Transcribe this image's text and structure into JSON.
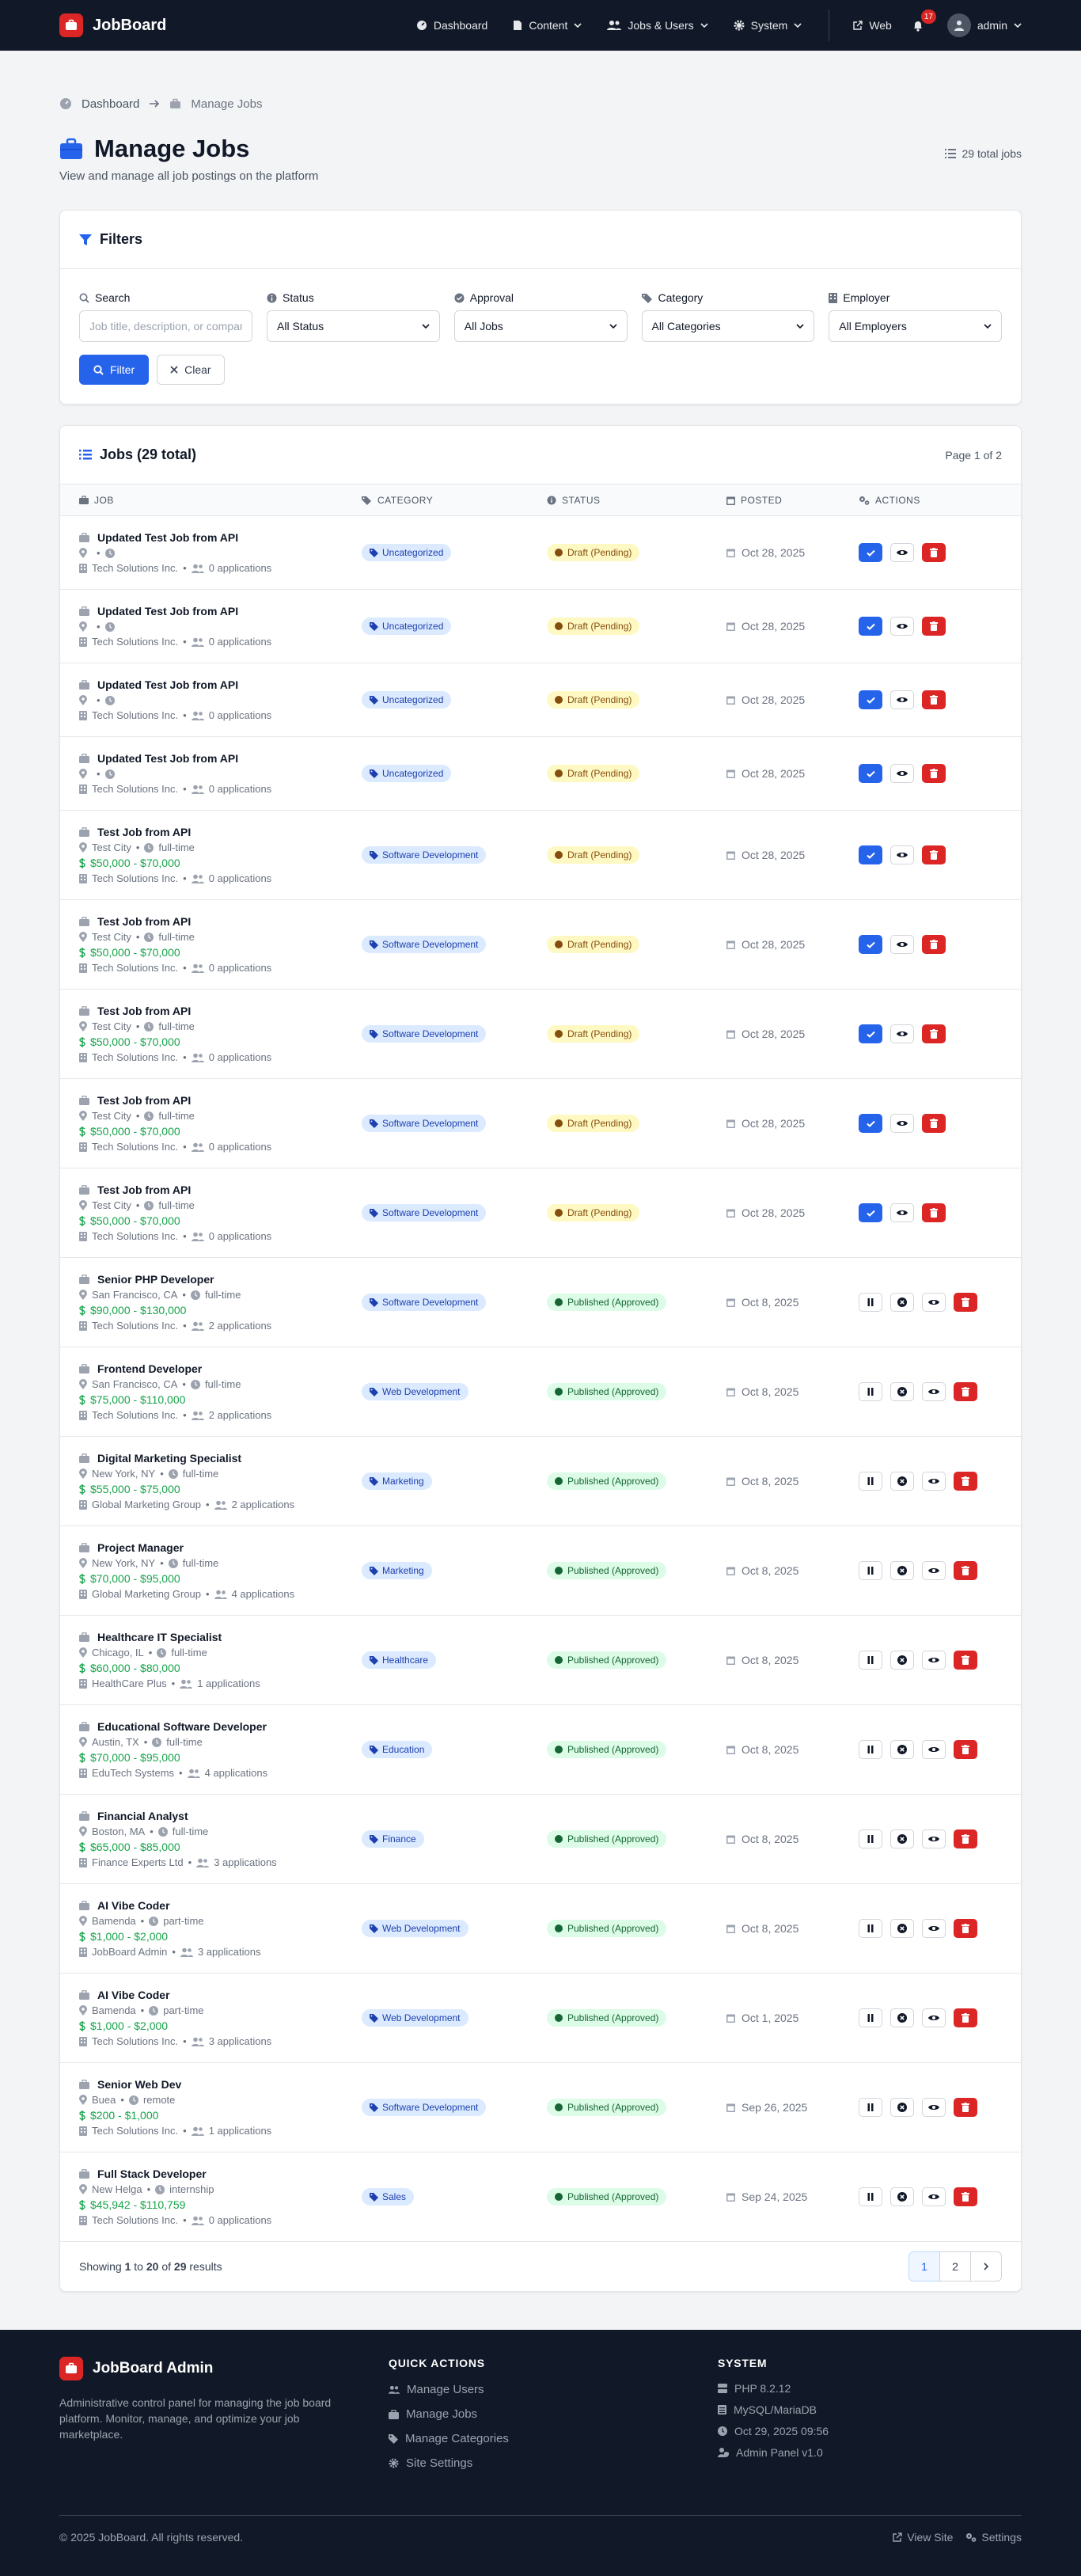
{
  "nav": {
    "brand": "JobBoard",
    "items": [
      {
        "label": "Dashboard",
        "icon": "gauge-icon",
        "caret": false
      },
      {
        "label": "Content",
        "icon": "file-icon",
        "caret": true
      },
      {
        "label": "Jobs & Users",
        "icon": "users-icon",
        "caret": true
      },
      {
        "label": "System",
        "icon": "gear-icon",
        "caret": true
      }
    ],
    "web": "Web",
    "notif_count": "17",
    "user": "admin"
  },
  "breadcrumb": {
    "home": "Dashboard",
    "current": "Manage Jobs"
  },
  "header": {
    "title": "Manage Jobs",
    "subtitle": "View and manage all job postings on the platform",
    "total": "29 total jobs"
  },
  "filters": {
    "title": "Filters",
    "search_label": "Search",
    "search_placeholder": "Job title, description, or company",
    "status_label": "Status",
    "status_value": "All Status",
    "approval_label": "Approval",
    "approval_value": "All Jobs",
    "category_label": "Category",
    "category_value": "All Categories",
    "employer_label": "Employer",
    "employer_value": "All Employers",
    "filter_btn": "Filter",
    "clear_btn": "Clear"
  },
  "jobs": {
    "title": "Jobs (29 total)",
    "page_of": "Page 1 of 2",
    "columns": [
      "Job",
      "Category",
      "Status",
      "Posted",
      "Actions"
    ],
    "rows": [
      {
        "title": "Updated Test Job from API",
        "location": "",
        "type": "",
        "salary": "",
        "company": "Tech Solutions Inc.",
        "applications": "0 applications",
        "category": "Uncategorized",
        "status": "Draft (Pending)",
        "kind": "draft",
        "posted": "Oct 28, 2025"
      },
      {
        "title": "Updated Test Job from API",
        "location": "",
        "type": "",
        "salary": "",
        "company": "Tech Solutions Inc.",
        "applications": "0 applications",
        "category": "Uncategorized",
        "status": "Draft (Pending)",
        "kind": "draft",
        "posted": "Oct 28, 2025"
      },
      {
        "title": "Updated Test Job from API",
        "location": "",
        "type": "",
        "salary": "",
        "company": "Tech Solutions Inc.",
        "applications": "0 applications",
        "category": "Uncategorized",
        "status": "Draft (Pending)",
        "kind": "draft",
        "posted": "Oct 28, 2025"
      },
      {
        "title": "Updated Test Job from API",
        "location": "",
        "type": "",
        "salary": "",
        "company": "Tech Solutions Inc.",
        "applications": "0 applications",
        "category": "Uncategorized",
        "status": "Draft (Pending)",
        "kind": "draft",
        "posted": "Oct 28, 2025"
      },
      {
        "title": "Test Job from API",
        "location": "Test City",
        "type": "full-time",
        "salary": "$50,000 - $70,000",
        "company": "Tech Solutions Inc.",
        "applications": "0 applications",
        "category": "Software Development",
        "status": "Draft (Pending)",
        "kind": "draft",
        "posted": "Oct 28, 2025"
      },
      {
        "title": "Test Job from API",
        "location": "Test City",
        "type": "full-time",
        "salary": "$50,000 - $70,000",
        "company": "Tech Solutions Inc.",
        "applications": "0 applications",
        "category": "Software Development",
        "status": "Draft (Pending)",
        "kind": "draft",
        "posted": "Oct 28, 2025"
      },
      {
        "title": "Test Job from API",
        "location": "Test City",
        "type": "full-time",
        "salary": "$50,000 - $70,000",
        "company": "Tech Solutions Inc.",
        "applications": "0 applications",
        "category": "Software Development",
        "status": "Draft (Pending)",
        "kind": "draft",
        "posted": "Oct 28, 2025"
      },
      {
        "title": "Test Job from API",
        "location": "Test City",
        "type": "full-time",
        "salary": "$50,000 - $70,000",
        "company": "Tech Solutions Inc.",
        "applications": "0 applications",
        "category": "Software Development",
        "status": "Draft (Pending)",
        "kind": "draft",
        "posted": "Oct 28, 2025"
      },
      {
        "title": "Test Job from API",
        "location": "Test City",
        "type": "full-time",
        "salary": "$50,000 - $70,000",
        "company": "Tech Solutions Inc.",
        "applications": "0 applications",
        "category": "Software Development",
        "status": "Draft (Pending)",
        "kind": "draft",
        "posted": "Oct 28, 2025"
      },
      {
        "title": "Senior PHP Developer",
        "location": "San Francisco, CA",
        "type": "full-time",
        "salary": "$90,000 - $130,000",
        "company": "Tech Solutions Inc.",
        "applications": "2 applications",
        "category": "Software Development",
        "status": "Published (Approved)",
        "kind": "pub",
        "posted": "Oct 8, 2025"
      },
      {
        "title": "Frontend Developer",
        "location": "San Francisco, CA",
        "type": "full-time",
        "salary": "$75,000 - $110,000",
        "company": "Tech Solutions Inc.",
        "applications": "2 applications",
        "category": "Web Development",
        "status": "Published (Approved)",
        "kind": "pub",
        "posted": "Oct 8, 2025"
      },
      {
        "title": "Digital Marketing Specialist",
        "location": "New York, NY",
        "type": "full-time",
        "salary": "$55,000 - $75,000",
        "company": "Global Marketing Group",
        "applications": "2 applications",
        "category": "Marketing",
        "status": "Published (Approved)",
        "kind": "pub",
        "posted": "Oct 8, 2025"
      },
      {
        "title": "Project Manager",
        "location": "New York, NY",
        "type": "full-time",
        "salary": "$70,000 - $95,000",
        "company": "Global Marketing Group",
        "applications": "4 applications",
        "category": "Marketing",
        "status": "Published (Approved)",
        "kind": "pub",
        "posted": "Oct 8, 2025"
      },
      {
        "title": "Healthcare IT Specialist",
        "location": "Chicago, IL",
        "type": "full-time",
        "salary": "$60,000 - $80,000",
        "company": "HealthCare Plus",
        "applications": "1 applications",
        "category": "Healthcare",
        "status": "Published (Approved)",
        "kind": "pub",
        "posted": "Oct 8, 2025"
      },
      {
        "title": "Educational Software Developer",
        "location": "Austin, TX",
        "type": "full-time",
        "salary": "$70,000 - $95,000",
        "company": "EduTech Systems",
        "applications": "4 applications",
        "category": "Education",
        "status": "Published (Approved)",
        "kind": "pub",
        "posted": "Oct 8, 2025"
      },
      {
        "title": "Financial Analyst",
        "location": "Boston, MA",
        "type": "full-time",
        "salary": "$65,000 - $85,000",
        "company": "Finance Experts Ltd",
        "applications": "3 applications",
        "category": "Finance",
        "status": "Published (Approved)",
        "kind": "pub",
        "posted": "Oct 8, 2025"
      },
      {
        "title": "AI Vibe Coder",
        "location": "Bamenda",
        "type": "part-time",
        "salary": "$1,000 - $2,000",
        "company": "JobBoard Admin",
        "applications": "3 applications",
        "category": "Web Development",
        "status": "Published (Approved)",
        "kind": "pub",
        "posted": "Oct 8, 2025"
      },
      {
        "title": "AI Vibe Coder",
        "location": "Bamenda",
        "type": "part-time",
        "salary": "$1,000 - $2,000",
        "company": "Tech Solutions Inc.",
        "applications": "3 applications",
        "category": "Web Development",
        "status": "Published (Approved)",
        "kind": "pub",
        "posted": "Oct 1, 2025"
      },
      {
        "title": "Senior Web Dev",
        "location": "Buea",
        "type": "remote",
        "salary": "$200 - $1,000",
        "company": "Tech Solutions Inc.",
        "applications": "1 applications",
        "category": "Software Development",
        "status": "Published (Approved)",
        "kind": "pub",
        "posted": "Sep 26, 2025"
      },
      {
        "title": "Full Stack Developer",
        "location": "New Helga",
        "type": "internship",
        "salary": "$45,942 - $110,759",
        "company": "Tech Solutions Inc.",
        "applications": "0 applications",
        "category": "Sales",
        "status": "Published (Approved)",
        "kind": "pub",
        "posted": "Sep 24, 2025"
      }
    ]
  },
  "pagination": {
    "showing_prefix": "Showing",
    "from": "1",
    "to_word": "to",
    "to": "20",
    "of_word": "of",
    "total": "29",
    "suffix": "results",
    "pages": [
      "1",
      "2"
    ]
  },
  "footer": {
    "brand": "JobBoard Admin",
    "desc": "Administrative control panel for managing the job board platform. Monitor, manage, and optimize your job marketplace.",
    "quick_title": "Quick Actions",
    "quick": [
      {
        "label": "Manage Users",
        "icon": "users-icon"
      },
      {
        "label": "Manage Jobs",
        "icon": "briefcase-icon"
      },
      {
        "label": "Manage Categories",
        "icon": "tag-icon"
      },
      {
        "label": "Site Settings",
        "icon": "gear-icon"
      }
    ],
    "system_title": "System",
    "system": [
      {
        "label": "PHP 8.2.12",
        "icon": "server-icon"
      },
      {
        "label": "MySQL/MariaDB",
        "icon": "database-icon"
      },
      {
        "label": "Oct 29, 2025 09:56",
        "icon": "clock-icon"
      },
      {
        "label": "Admin Panel v1.0",
        "icon": "user-shield-icon"
      }
    ],
    "copyright": "© 2025 JobBoard. All rights reserved.",
    "view_site": "View Site",
    "settings": "Settings"
  },
  "colors": {
    "nav_bg": "#111827",
    "brand_red": "#dc2626",
    "primary_blue": "#2563eb",
    "success_green": "#16a34a",
    "draft_yellow": "#fef9c3"
  }
}
